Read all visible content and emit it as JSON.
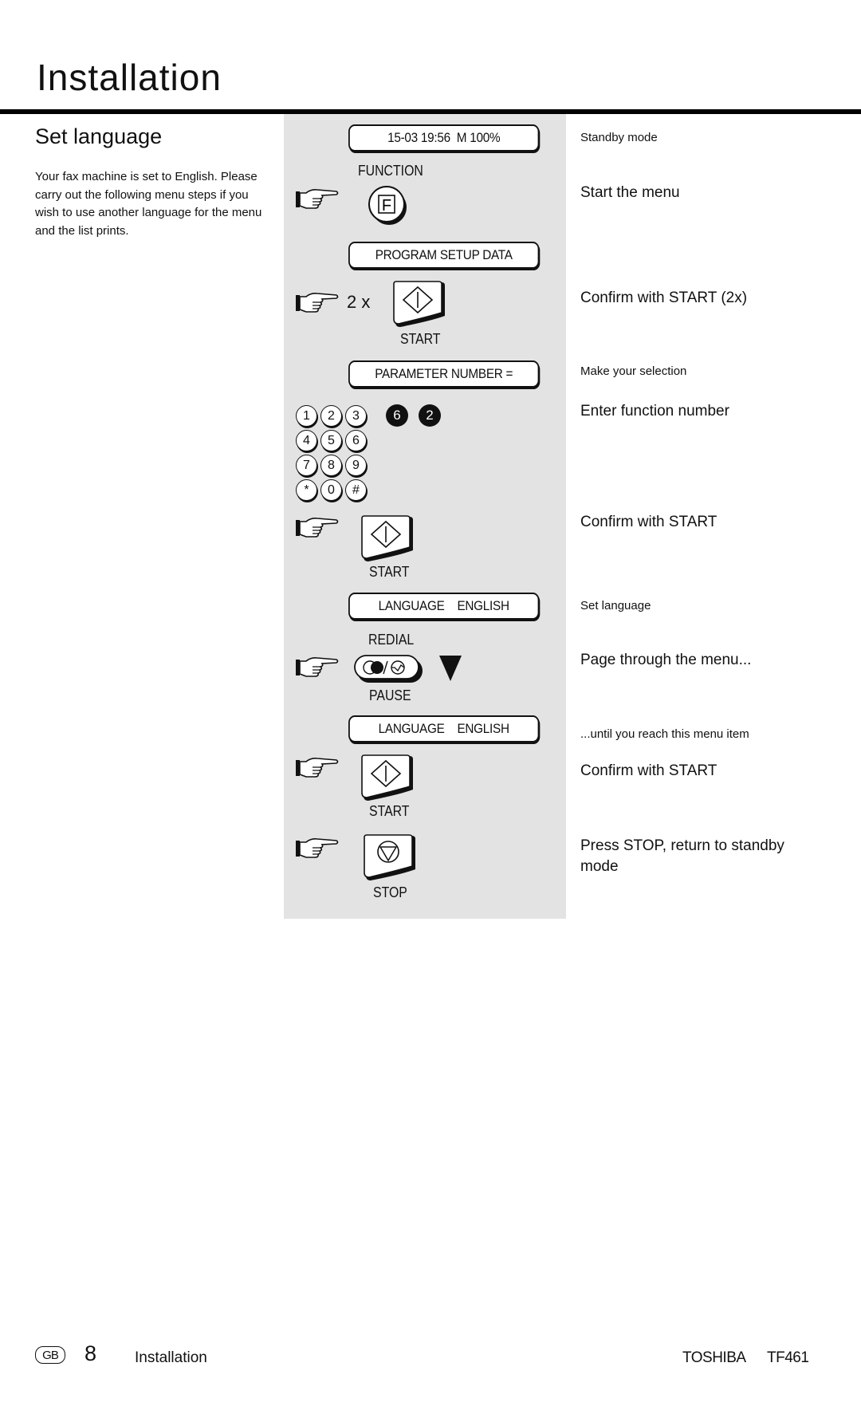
{
  "page": {
    "title": "Installation",
    "section_title": "Set language",
    "intro": "Your fax machine is set to English. Please carry out the following menu steps if you wish to use another language for the menu and the list prints."
  },
  "steps": {
    "lcd_standby": "15-03 19:56  M 100%",
    "function_label": "FUNCTION",
    "function_key": "F",
    "lcd_program": "PROGRAM SETUP DATA",
    "repeat_count": "2 x",
    "start_label": "START",
    "lcd_parameter": "PARAMETER NUMBER =",
    "keypad": [
      "1",
      "2",
      "3",
      "4",
      "5",
      "6",
      "7",
      "8",
      "9",
      "*",
      "0",
      "#"
    ],
    "entered_digits": [
      "6",
      "2"
    ],
    "lcd_language_1": "LANGUAGE    ENGLISH",
    "redial_label": "REDIAL",
    "pause_label": "PAUSE",
    "lcd_language_2": "LANGUAGE    ENGLISH",
    "stop_label": "STOP"
  },
  "notes": {
    "standby": "Standby mode",
    "start_menu": "Start the menu",
    "confirm_2x": "Confirm with START (2x)",
    "make_selection": "Make your selection",
    "enter_function": "Enter function number",
    "confirm_1": "Confirm with START",
    "set_language": "Set language",
    "page_through": "Page through the menu...",
    "until_reach": "...until you reach this menu item",
    "confirm_2": "Confirm with START",
    "press_stop": "Press STOP, return to standby mode"
  },
  "footer": {
    "country": "GB",
    "page_number": "8",
    "section": "Installation",
    "brand": "TOSHIBA",
    "model": "TF461"
  }
}
